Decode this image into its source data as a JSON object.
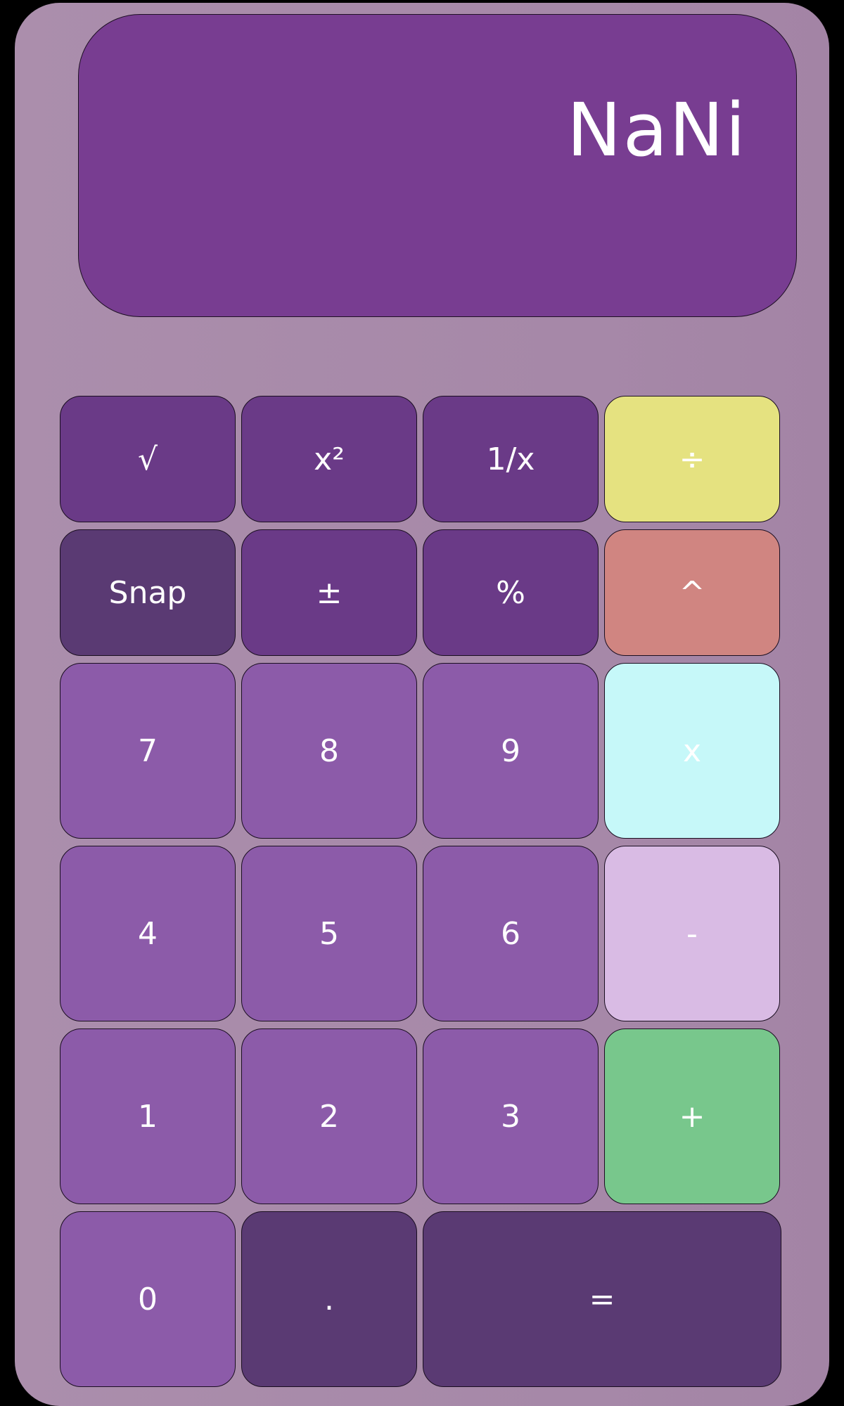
{
  "display": {
    "value": "NaNi"
  },
  "keys": {
    "sqrt": "√",
    "square": "x²",
    "reciprocal": "1/x",
    "divide": "÷",
    "snap": "Snap",
    "plus_minus": "±",
    "percent": "%",
    "power": "^",
    "seven": "7",
    "eight": "8",
    "nine": "9",
    "multiply": "x",
    "four": "4",
    "five": "5",
    "six": "6",
    "minus": "-",
    "one": "1",
    "two": "2",
    "three": "3",
    "plus": "+",
    "zero": "0",
    "decimal": ".",
    "equals": "="
  },
  "colors": {
    "body": "#a688a8",
    "display": "#783d91",
    "function_key": "#6a3a87",
    "digit_key": "#8c5ba9",
    "dark_key": "#5a3a73",
    "divide_key": "#e5e280",
    "power_key": "#d08581",
    "multiply_key": "#c6f8f9",
    "minus_key": "#d9bbe4",
    "plus_key": "#78c78c"
  }
}
